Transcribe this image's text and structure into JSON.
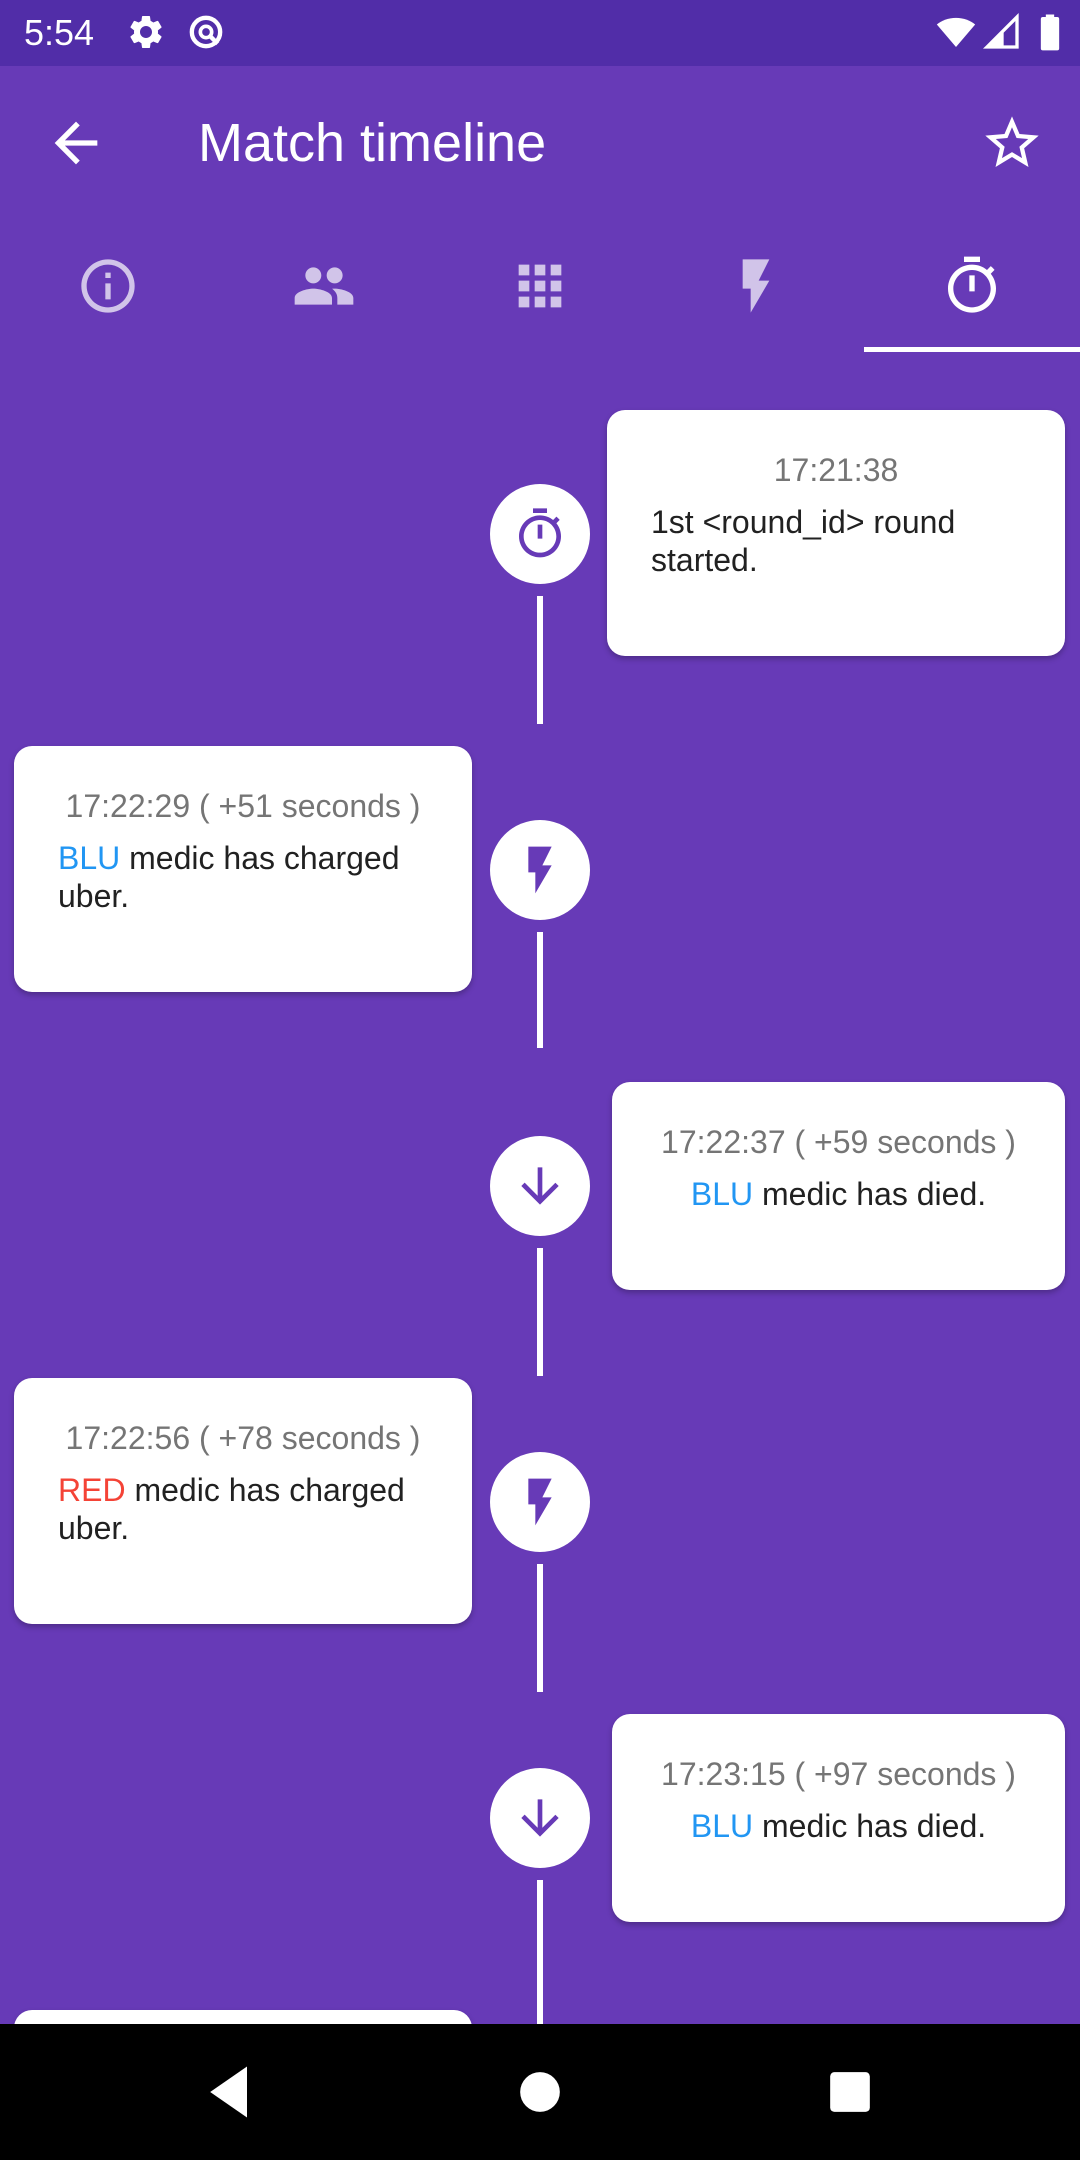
{
  "status_bar": {
    "time": "5:54"
  },
  "app_bar": {
    "title": "Match timeline"
  },
  "tabs": [
    {
      "icon": "info-icon"
    },
    {
      "icon": "players-icon"
    },
    {
      "icon": "grid-icon"
    },
    {
      "icon": "lightning-icon"
    },
    {
      "icon": "stopwatch-icon",
      "selected": true
    }
  ],
  "events": [
    {
      "timestamp": "17:21:38",
      "team": "",
      "message": "1st <round_id> round started.",
      "icon": "stopwatch-icon"
    },
    {
      "timestamp": "17:22:29 ( +51 seconds )",
      "team": "BLU",
      "message": " medic has charged uber.",
      "icon": "lightning-icon"
    },
    {
      "timestamp": "17:22:37 ( +59 seconds )",
      "team": "BLU",
      "message": " medic has died.",
      "icon": "arrow-down-icon"
    },
    {
      "timestamp": "17:22:56 ( +78 seconds )",
      "team": "RED",
      "message": " medic has charged uber.",
      "icon": "lightning-icon"
    },
    {
      "timestamp": "17:23:15 ( +97 seconds )",
      "team": "BLU",
      "message": " medic has died.",
      "icon": "arrow-down-icon"
    }
  ],
  "colors": {
    "primary": "#673ab7",
    "status_bar": "#512da8",
    "blu": "#2196f3",
    "red": "#f44336"
  }
}
